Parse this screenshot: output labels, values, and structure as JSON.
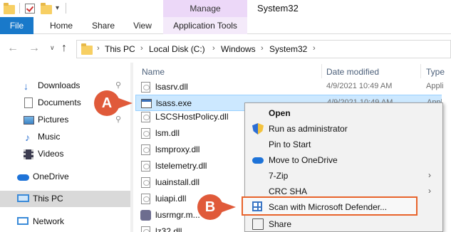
{
  "window": {
    "title": "System32",
    "contextual_tab_group": "Manage",
    "ribbon_tabs": [
      "File",
      "Home",
      "Share",
      "View",
      "Application Tools"
    ]
  },
  "address_bar": {
    "path": [
      "This PC",
      "Local Disk (C:)",
      "Windows",
      "System32"
    ]
  },
  "sidebar": {
    "items": [
      {
        "label": "Downloads",
        "icon": "download-arrow-icon",
        "pinned": true
      },
      {
        "label": "Documents",
        "icon": "documents-icon",
        "pinned": true
      },
      {
        "label": "Pictures",
        "icon": "pictures-icon",
        "pinned": true
      },
      {
        "label": "Music",
        "icon": "music-note-icon",
        "pinned": false
      },
      {
        "label": "Videos",
        "icon": "videos-icon",
        "pinned": false
      },
      {
        "label": "OneDrive",
        "icon": "onedrive-cloud-icon",
        "pinned": false
      },
      {
        "label": "This PC",
        "icon": "this-pc-icon",
        "pinned": false,
        "selected": true
      },
      {
        "label": "Network",
        "icon": "network-icon",
        "pinned": false
      }
    ]
  },
  "file_list": {
    "columns": [
      "Name",
      "Date modified",
      "Type"
    ],
    "rows": [
      {
        "name": "lsasrv.dll",
        "date": "4/9/2021 10:49 AM",
        "type": "Appli"
      },
      {
        "name": "lsass.exe",
        "date": "4/9/2021 10:49 AM",
        "type": "Appli",
        "selected": true
      },
      {
        "name": "LSCSHostPolicy.dll",
        "date": "",
        "type": ""
      },
      {
        "name": "lsm.dll",
        "date": "",
        "type": ""
      },
      {
        "name": "lsmproxy.dll",
        "date": "",
        "type": ""
      },
      {
        "name": "lstelemetry.dll",
        "date": "",
        "type": ""
      },
      {
        "name": "luainstall.dll",
        "date": "",
        "type": ""
      },
      {
        "name": "luiapi.dll",
        "date": "",
        "type": ""
      },
      {
        "name": "lusrmgr.m...",
        "date": "",
        "type": ""
      },
      {
        "name": "lz32.dll",
        "date": "",
        "type": ""
      }
    ]
  },
  "context_menu": {
    "items": [
      {
        "label": "Open",
        "bold": true,
        "icon": "",
        "submenu": false
      },
      {
        "label": "Run as administrator",
        "icon": "uac-shield-icon",
        "submenu": false
      },
      {
        "label": "Pin to Start",
        "icon": "",
        "submenu": false
      },
      {
        "label": "Move to OneDrive",
        "icon": "onedrive-cloud-icon",
        "submenu": false
      },
      {
        "label": "7-Zip",
        "icon": "",
        "submenu": true
      },
      {
        "label": "CRC SHA",
        "icon": "",
        "submenu": true
      },
      {
        "label": "Scan with Microsoft Defender...",
        "icon": "defender-icon",
        "submenu": false,
        "highlighted": true
      },
      {
        "label": "Share",
        "icon": "share-icon",
        "submenu": false
      }
    ]
  },
  "callouts": {
    "a": "A",
    "b": "B"
  },
  "colors": {
    "accent": "#1979ca",
    "manage_tab": "#ecd8f8",
    "callout": "#e05a3a",
    "highlight_border": "#e8632b",
    "selection": "#cce8ff"
  }
}
